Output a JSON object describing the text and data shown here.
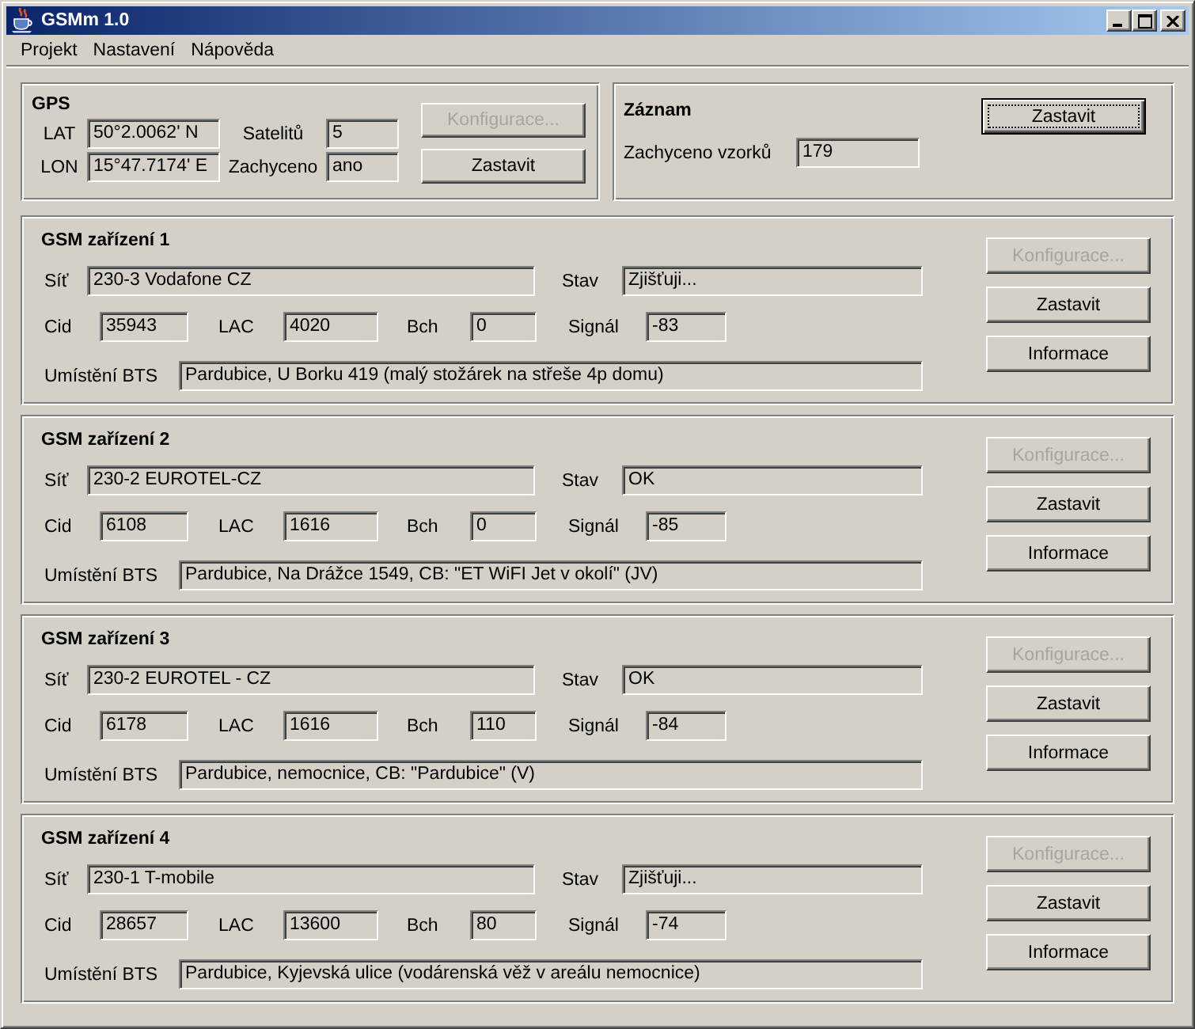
{
  "window": {
    "title": "GSMm 1.0"
  },
  "menu": [
    "Projekt",
    "Nastavení",
    "Nápověda"
  ],
  "gps": {
    "title": "GPS",
    "fields": [
      {
        "label": "LAT",
        "value": "50°2.0062' N"
      },
      {
        "label": "Satelitů",
        "value": "5"
      },
      {
        "label": "LON",
        "value": "15°47.7174' E"
      },
      {
        "label": "Zachyceno",
        "value": "ano"
      }
    ],
    "buttons": [
      {
        "label": "Konfigurace...",
        "disabled": true,
        "focused": false
      },
      {
        "label": "Zastavit",
        "disabled": false,
        "focused": false
      }
    ]
  },
  "recording": {
    "title": "Záznam",
    "button": {
      "label": "Zastavit",
      "disabled": false,
      "focused": true
    },
    "field": {
      "label": "Zachyceno vzorků",
      "value": "179"
    }
  },
  "devices": [
    {
      "title": "GSM zařízení 1",
      "fields": [
        {
          "label": "Síť",
          "value": "230-3 Vodafone CZ"
        },
        {
          "label": "Stav",
          "value": "Zjišťuji..."
        },
        {
          "label": "Cid",
          "value": "35943"
        },
        {
          "label": "LAC",
          "value": "4020"
        },
        {
          "label": "Bch",
          "value": "0"
        },
        {
          "label": "Signál",
          "value": "-83"
        },
        {
          "label": "Umístění BTS",
          "value": "Pardubice, U Borku 419 (malý stožárek na střeše 4p domu)"
        }
      ],
      "buttons": [
        {
          "label": "Konfigurace...",
          "disabled": true,
          "focused": false
        },
        {
          "label": "Zastavit",
          "disabled": false,
          "focused": false
        },
        {
          "label": "Informace",
          "disabled": false,
          "focused": false
        }
      ]
    },
    {
      "title": "GSM zařízení 2",
      "fields": [
        {
          "label": "Síť",
          "value": "230-2 EUROTEL-CZ"
        },
        {
          "label": "Stav",
          "value": "OK"
        },
        {
          "label": "Cid",
          "value": "6108"
        },
        {
          "label": "LAC",
          "value": "1616"
        },
        {
          "label": "Bch",
          "value": "0"
        },
        {
          "label": "Signál",
          "value": "-85"
        },
        {
          "label": "Umístění BTS",
          "value": "Pardubice, Na Drážce 1549, CB: \"ET WiFI Jet v okolí\" (JV)"
        }
      ],
      "buttons": [
        {
          "label": "Konfigurace...",
          "disabled": true,
          "focused": false
        },
        {
          "label": "Zastavit",
          "disabled": false,
          "focused": false
        },
        {
          "label": "Informace",
          "disabled": false,
          "focused": false
        }
      ]
    },
    {
      "title": "GSM zařízení 3",
      "fields": [
        {
          "label": "Síť",
          "value": "230-2 EUROTEL - CZ"
        },
        {
          "label": "Stav",
          "value": "OK"
        },
        {
          "label": "Cid",
          "value": "6178"
        },
        {
          "label": "LAC",
          "value": "1616"
        },
        {
          "label": "Bch",
          "value": "110"
        },
        {
          "label": "Signál",
          "value": "-84"
        },
        {
          "label": "Umístění BTS",
          "value": "Pardubice, nemocnice, CB: \"Pardubice\" (V)"
        }
      ],
      "buttons": [
        {
          "label": "Konfigurace...",
          "disabled": true,
          "focused": false
        },
        {
          "label": "Zastavit",
          "disabled": false,
          "focused": false
        },
        {
          "label": "Informace",
          "disabled": false,
          "focused": false
        }
      ]
    },
    {
      "title": "GSM zařízení 4",
      "fields": [
        {
          "label": "Síť",
          "value": "230-1 T-mobile"
        },
        {
          "label": "Stav",
          "value": "Zjišťuji..."
        },
        {
          "label": "Cid",
          "value": "28657"
        },
        {
          "label": "LAC",
          "value": "13600"
        },
        {
          "label": "Bch",
          "value": "80"
        },
        {
          "label": "Signál",
          "value": "-74"
        },
        {
          "label": "Umístění BTS",
          "value": "Pardubice, Kyjevská ulice (vodárenská věž v areálu nemocnice)"
        }
      ],
      "buttons": [
        {
          "label": "Konfigurace...",
          "disabled": true,
          "focused": false
        },
        {
          "label": "Zastavit",
          "disabled": false,
          "focused": false
        },
        {
          "label": "Informace",
          "disabled": false,
          "focused": false
        }
      ]
    }
  ]
}
